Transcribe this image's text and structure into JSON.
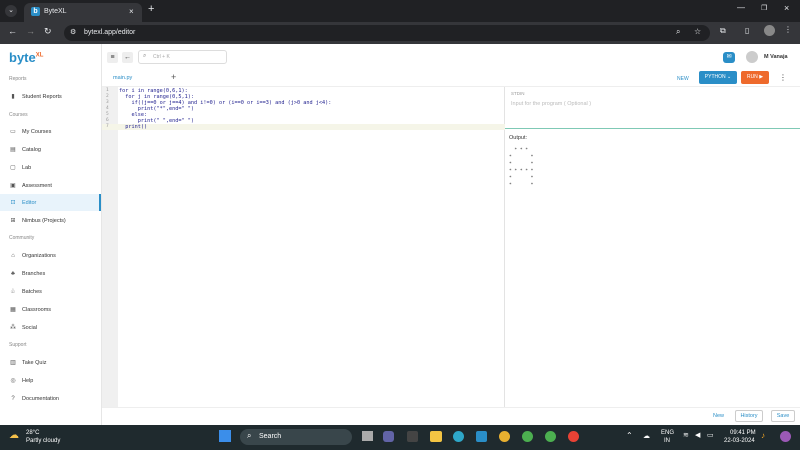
{
  "browser": {
    "tab_title": "ByteXL",
    "url": "bytexl.app/editor"
  },
  "app": {
    "logo_text": "byte",
    "logo_sup": "XL",
    "search_placeholder": "Ctrl + K",
    "user_name": "M Vanaja"
  },
  "sidebar": {
    "sections": {
      "reports": "Reports",
      "courses": "Courses",
      "community": "Community",
      "support": "Support"
    },
    "items": [
      {
        "label": "Student Reports",
        "icon": "chart-icon"
      },
      {
        "label": "My Courses",
        "icon": "book-icon"
      },
      {
        "label": "Catalog",
        "icon": "catalog-icon"
      },
      {
        "label": "Lab",
        "icon": "lab-icon"
      },
      {
        "label": "Assessment",
        "icon": "assessment-icon"
      },
      {
        "label": "Editor",
        "icon": "editor-icon"
      },
      {
        "label": "Nimbus (Projects)",
        "icon": "project-icon"
      },
      {
        "label": "Organizations",
        "icon": "bank-icon"
      },
      {
        "label": "Branches",
        "icon": "branches-icon"
      },
      {
        "label": "Batches",
        "icon": "batches-icon"
      },
      {
        "label": "Classrooms",
        "icon": "classroom-icon"
      },
      {
        "label": "Social",
        "icon": "social-icon"
      },
      {
        "label": "Take Quiz",
        "icon": "quiz-icon"
      },
      {
        "label": "Help",
        "icon": "help-icon"
      },
      {
        "label": "Documentation",
        "icon": "doc-icon"
      }
    ]
  },
  "editor": {
    "file_tab": "main.py",
    "new_label": "NEW",
    "language": "PYTHON",
    "run_label": "RUN",
    "code_lines": [
      "for i in range(0,6,1):",
      "  for j in range(0,5,1):",
      "    if((j==0 or j==4) and i!=0) or (i==0 or i==3) and (j>0 and j<4):",
      "      print(\"*\",end=\" \")",
      "    else:",
      "      print(\" \",end=\" \")",
      "  print()"
    ],
    "line_numbers": [
      "1",
      "2",
      "3",
      "4",
      "5",
      "6",
      "7"
    ]
  },
  "stdin": {
    "label": "STDIN",
    "placeholder": "Input for the program ( Optional )"
  },
  "output": {
    "label": "Output:",
    "lines": [
      "  * * *",
      "*       *",
      "*       *",
      "* * * * *",
      "*       *",
      "*       *"
    ]
  },
  "bottom": {
    "new_label": "New",
    "history_label": "History",
    "save_label": "Save"
  },
  "taskbar": {
    "temp": "28°C",
    "weather": "Partly cloudy",
    "search_label": "Search",
    "lang_top": "ENG",
    "lang_bottom": "IN",
    "time": "09:41 PM",
    "date": "22-03-2024"
  },
  "colors": {
    "accent": "#2a8ec7",
    "run": "#ee6a2c",
    "python": "#2a8ec7",
    "logo": "#2a8ec7"
  }
}
